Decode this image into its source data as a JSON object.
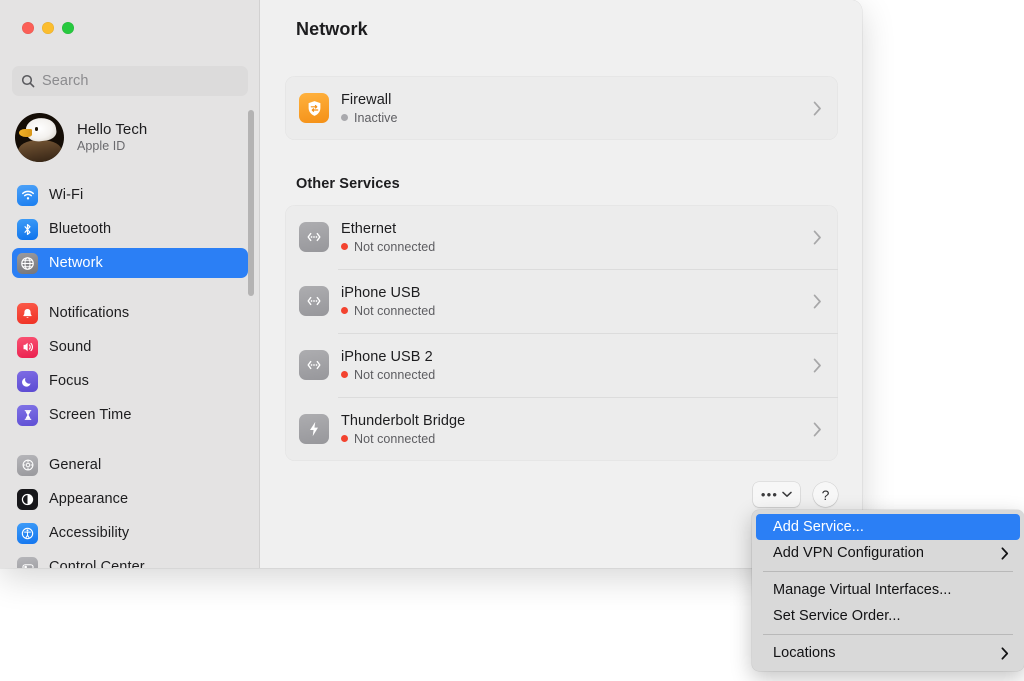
{
  "window": {
    "traffic_lights": [
      {
        "name": "close",
        "color": "#fb5f57"
      },
      {
        "name": "minimize",
        "color": "#fbbd2e"
      },
      {
        "name": "zoom",
        "color": "#27c93f"
      }
    ]
  },
  "sidebar": {
    "search": {
      "placeholder": "Search",
      "value": "",
      "icon": "search-icon"
    },
    "account": {
      "name": "Hello Tech",
      "subtitle": "Apple ID",
      "avatar": "eagle-avatar"
    },
    "groups": [
      {
        "items": [
          {
            "label": "Wi-Fi",
            "icon": "wifi-icon",
            "selected": false
          },
          {
            "label": "Bluetooth",
            "icon": "bluetooth-icon",
            "selected": false
          },
          {
            "label": "Network",
            "icon": "network-globe-icon",
            "selected": true
          }
        ]
      },
      {
        "items": [
          {
            "label": "Notifications",
            "icon": "notifications-bell-icon",
            "selected": false
          },
          {
            "label": "Sound",
            "icon": "sound-speaker-icon",
            "selected": false
          },
          {
            "label": "Focus",
            "icon": "focus-moon-icon",
            "selected": false
          },
          {
            "label": "Screen Time",
            "icon": "screen-time-hourglass-icon",
            "selected": false
          }
        ]
      },
      {
        "items": [
          {
            "label": "General",
            "icon": "general-gear-icon",
            "selected": false
          },
          {
            "label": "Appearance",
            "icon": "appearance-contrast-icon",
            "selected": false
          },
          {
            "label": "Accessibility",
            "icon": "accessibility-person-icon",
            "selected": false
          },
          {
            "label": "Control Center",
            "icon": "control-center-icon",
            "selected": false
          }
        ]
      }
    ]
  },
  "main": {
    "title": "Network",
    "firewall_card": {
      "rows": [
        {
          "title": "Firewall",
          "status": "Inactive",
          "status_color": "#a9a9ad",
          "icon": "firewall-shield-icon",
          "icon_style": "orange"
        }
      ]
    },
    "other_services_title": "Other Services",
    "services_card": {
      "rows": [
        {
          "title": "Ethernet",
          "status": "Not connected",
          "status_color": "#f3432f",
          "icon": "ethernet-icon",
          "icon_style": "gray"
        },
        {
          "title": "iPhone USB",
          "status": "Not connected",
          "status_color": "#f3432f",
          "icon": "ethernet-icon",
          "icon_style": "gray"
        },
        {
          "title": "iPhone USB 2",
          "status": "Not connected",
          "status_color": "#f3432f",
          "icon": "ethernet-icon",
          "icon_style": "gray"
        },
        {
          "title": "Thunderbolt Bridge",
          "status": "Not connected",
          "status_color": "#f3432f",
          "icon": "thunderbolt-icon",
          "icon_style": "gray"
        }
      ]
    },
    "footer": {
      "more_button": {
        "glyph": "•••",
        "icon": "chevron-down-icon"
      },
      "help_button": {
        "glyph": "?"
      }
    }
  },
  "context_menu": {
    "items": [
      {
        "label": "Add Service...",
        "highlight": true,
        "submenu": false
      },
      {
        "label": "Add VPN Configuration",
        "highlight": false,
        "submenu": true
      },
      {
        "separator": true
      },
      {
        "label": "Manage Virtual Interfaces...",
        "highlight": false,
        "submenu": false
      },
      {
        "label": "Set Service Order...",
        "highlight": false,
        "submenu": false
      },
      {
        "separator": true
      },
      {
        "label": "Locations",
        "highlight": false,
        "submenu": true
      }
    ],
    "submenu_arrow": "›"
  },
  "colors": {
    "accent": "#2b7ff5",
    "sidebar_bg": "#e4e3e3",
    "main_bg": "#f0f0f0",
    "card_bg": "#ececec",
    "menu_bg": "#d9d9d9"
  }
}
